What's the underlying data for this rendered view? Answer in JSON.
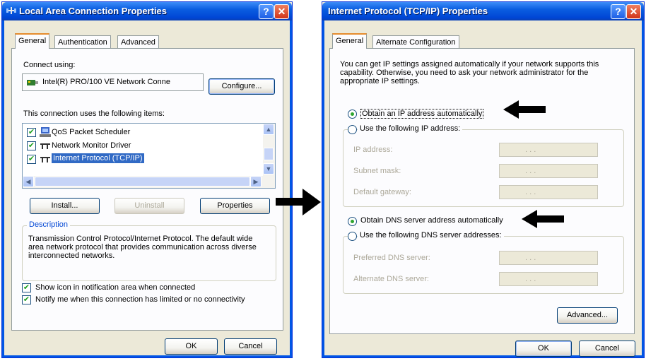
{
  "lac": {
    "title": "Local Area Connection Properties",
    "tabs": [
      "General",
      "Authentication",
      "Advanced"
    ],
    "connect_using_label": "Connect using:",
    "adapter_name": "Intel(R) PRO/100 VE Network Conne",
    "configure_label": "Configure...",
    "items_label": "This connection uses the following items:",
    "items": [
      {
        "label": "QoS Packet Scheduler",
        "checked": true,
        "icon": "scheduler-icon"
      },
      {
        "label": "Network Monitor Driver",
        "checked": true,
        "icon": "network-protocol-icon"
      },
      {
        "label": "Internet Protocol (TCP/IP)",
        "checked": true,
        "icon": "network-protocol-icon",
        "selected": true
      }
    ],
    "install_label": "Install...",
    "uninstall_label": "Uninstall",
    "properties_label": "Properties",
    "description_title": "Description",
    "description_text": "Transmission Control Protocol/Internet Protocol. The default wide area network protocol that provides communication across diverse interconnected networks.",
    "show_icon_label": "Show icon in notification area when connected",
    "show_icon_checked": true,
    "notify_label": "Notify me when this connection has limited or no connectivity",
    "notify_checked": true,
    "ok_label": "OK",
    "cancel_label": "Cancel"
  },
  "tcpip": {
    "title": "Internet Protocol (TCP/IP) Properties",
    "tabs": [
      "General",
      "Alternate Configuration"
    ],
    "intro_text": "You can get IP settings assigned automatically if your network supports this capability. Otherwise, you need to ask your network administrator for the appropriate IP settings.",
    "obtain_ip_label": "Obtain an IP address automatically",
    "use_ip_label": "Use the following IP address:",
    "ip_address_label": "IP address:",
    "subnet_label": "Subnet mask:",
    "gateway_label": "Default gateway:",
    "obtain_dns_label": "Obtain DNS server address automatically",
    "use_dns_label": "Use the following DNS server addresses:",
    "preferred_dns_label": "Preferred DNS server:",
    "alternate_dns_label": "Alternate DNS server:",
    "ip_placeholder": ".   .   .",
    "advanced_label": "Advanced...",
    "ok_label": "OK",
    "cancel_label": "Cancel"
  },
  "colors": {
    "titlebar": "#0a5de0",
    "dialog_bg": "#ece9d8",
    "selection": "#316ac5",
    "check_green": "#21a121"
  }
}
